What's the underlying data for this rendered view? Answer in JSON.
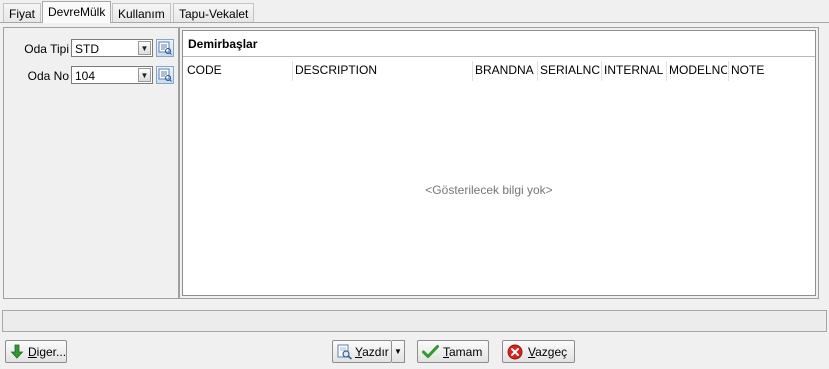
{
  "tabs": [
    {
      "label": "Fiyat"
    },
    {
      "label": "DevreMülk"
    },
    {
      "label": "Kullanım"
    },
    {
      "label": "Tapu-Vekalet"
    }
  ],
  "left_panel": {
    "oda_tipi": {
      "label": "Oda Tipi",
      "value": "STD"
    },
    "oda_no": {
      "label": "Oda No",
      "value": "104"
    }
  },
  "grid": {
    "title": "Demirbaşlar",
    "columns": [
      "CODE",
      "DESCRIPTION",
      "BRANDNA",
      "SERIALNC",
      "INTERNAL",
      "MODELNC",
      "NOTE"
    ],
    "empty_message": "<Gösterilecek bilgi yok>"
  },
  "buttons": {
    "diger": {
      "mnemonic": "D",
      "rest": "iger..."
    },
    "yazdir": {
      "mnemonic": "Y",
      "rest": "azdır"
    },
    "tamam": {
      "mnemonic": "T",
      "rest": "amam"
    },
    "vazgec": {
      "mnemonic": "V",
      "rest": "azgeç"
    }
  },
  "icons": {
    "diger": "green-down-arrow-icon",
    "yazdir": "print-preview-icon",
    "tamam": "green-check-icon",
    "vazgec": "red-cancel-icon"
  },
  "colors": {
    "window_bg": "#f0f0f0",
    "border": "#a0a0a0",
    "ok_green": "#3aa33a",
    "cancel_red": "#d9241c"
  }
}
